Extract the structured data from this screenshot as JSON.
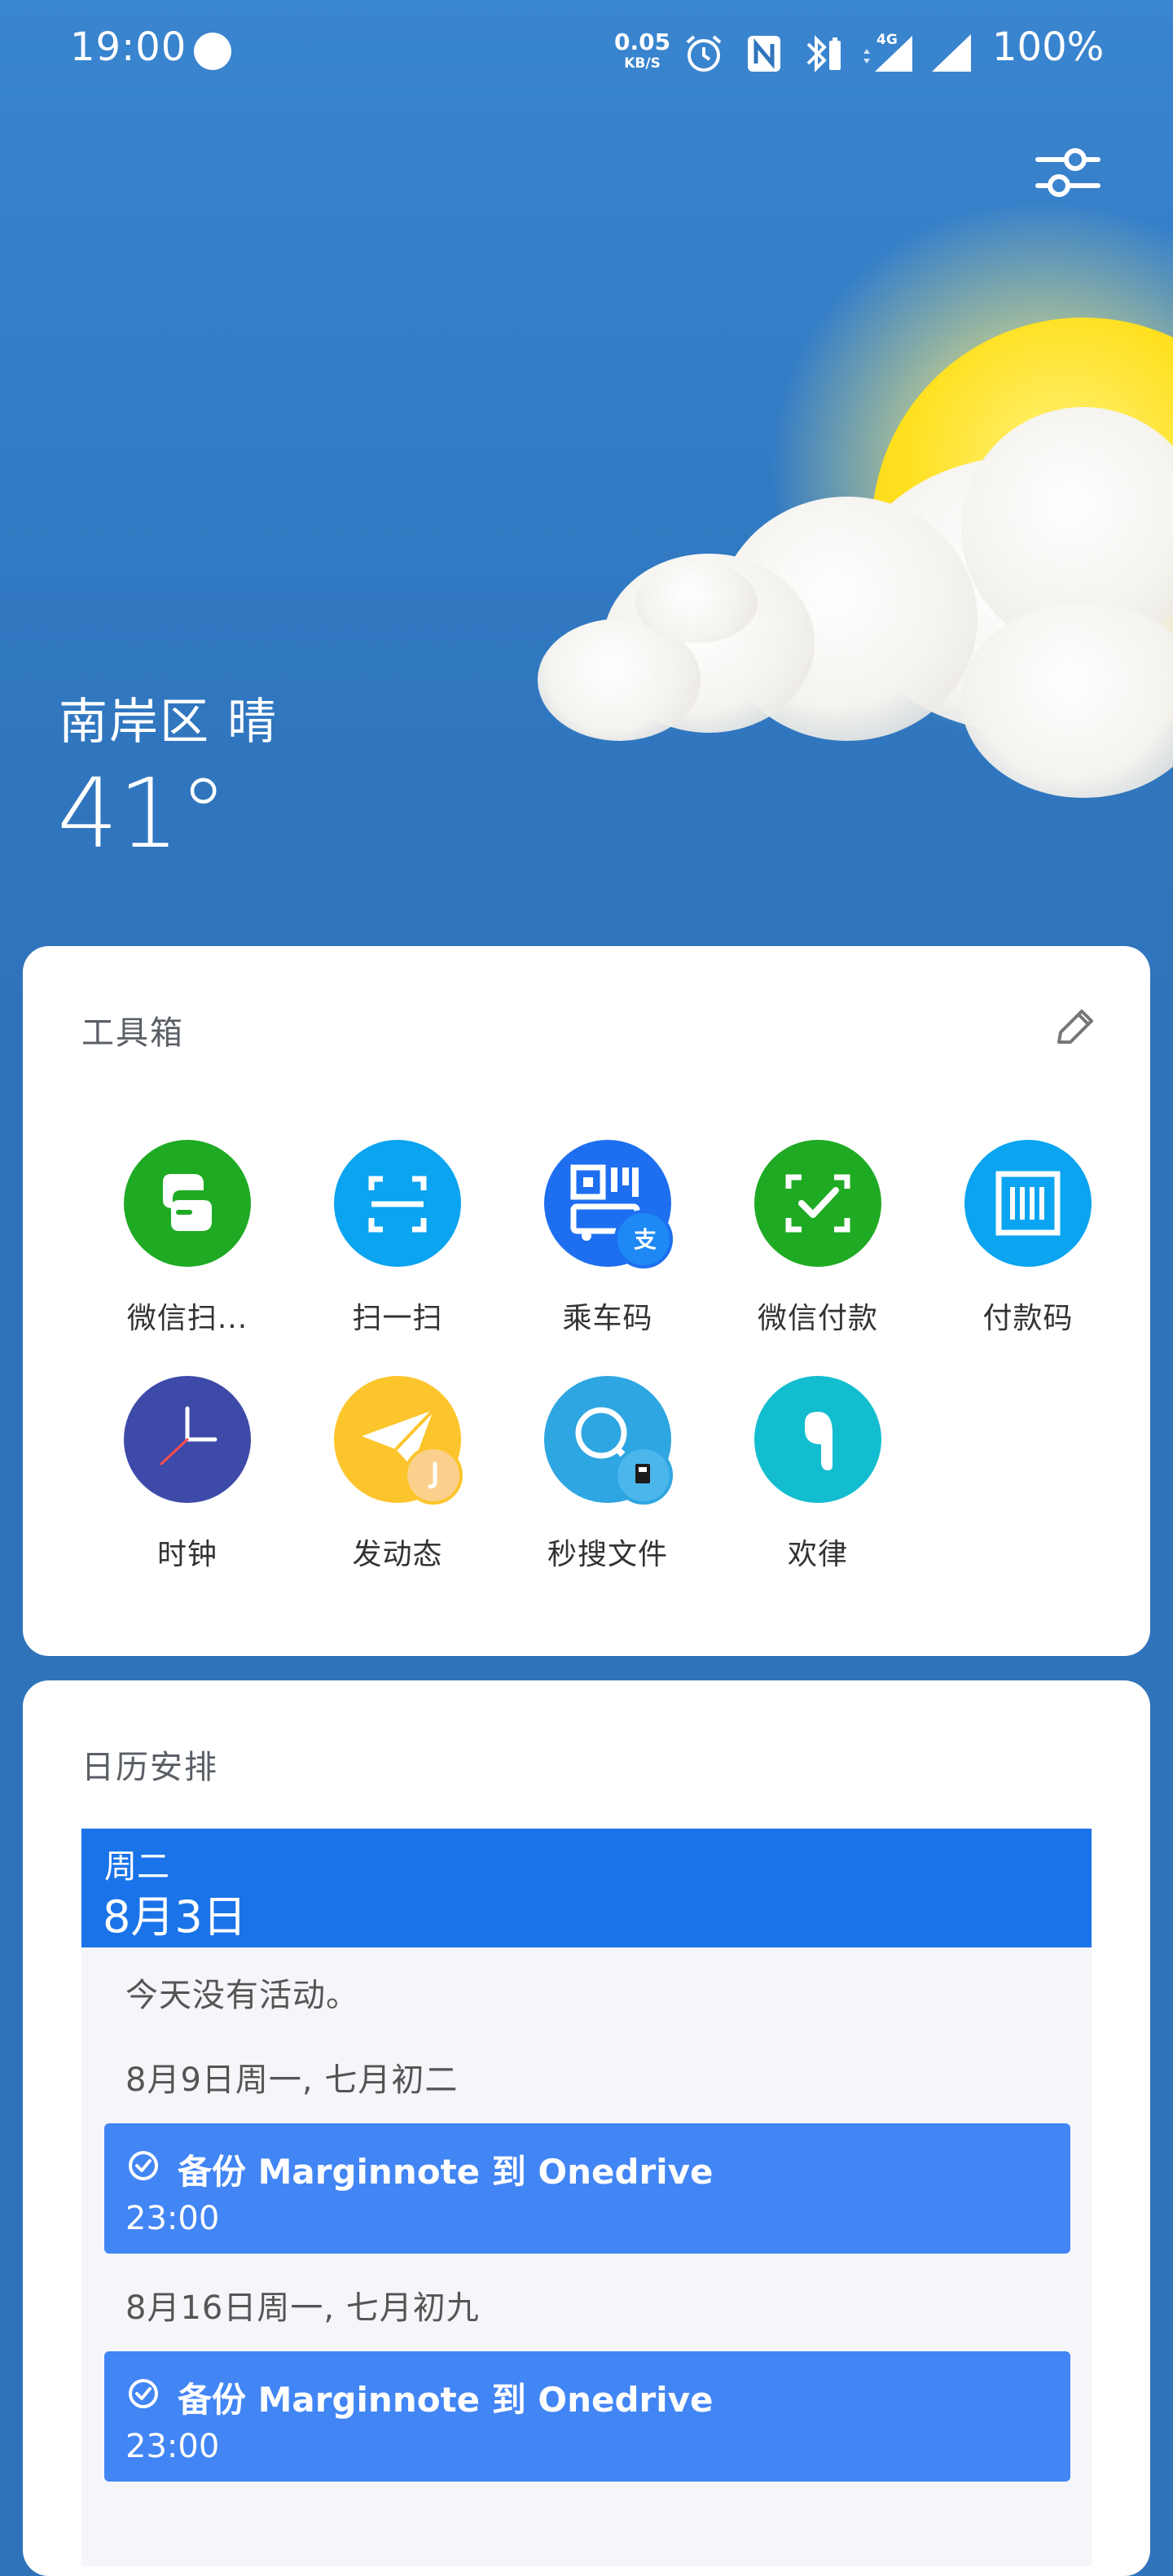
{
  "status_bar": {
    "time": "19:00",
    "net_speed_value": "0.05",
    "net_speed_unit": "KB/S",
    "network_type": "4G",
    "battery": "100%"
  },
  "weather": {
    "location": "南岸区 晴",
    "temperature": "41°"
  },
  "toolbox": {
    "title": "工具箱",
    "items": [
      {
        "label": "微信扫...",
        "icon": "wechat-scan-icon",
        "color": "#1faa24"
      },
      {
        "label": "扫一扫",
        "icon": "scan-icon",
        "color": "#0aa4f0"
      },
      {
        "label": "乘车码",
        "icon": "bus-code-icon",
        "color": "#1e6ff0"
      },
      {
        "label": "微信付款",
        "icon": "wechat-pay-icon",
        "color": "#1faa24"
      },
      {
        "label": "付款码",
        "icon": "pay-code-icon",
        "color": "#0aa4f0"
      },
      {
        "label": "时钟",
        "icon": "clock-icon",
        "color": "#3d4aa8"
      },
      {
        "label": "发动态",
        "icon": "post-icon",
        "color": "#fcc52b"
      },
      {
        "label": "秒搜文件",
        "icon": "file-search-icon",
        "color": "#2ea6e2"
      },
      {
        "label": "欢律",
        "icon": "heytap-music-icon",
        "color": "#13bdd0"
      }
    ]
  },
  "calendar": {
    "title": "日历安排",
    "day_of_week": "周二",
    "date": "8月3日",
    "no_events": "今天没有活动。",
    "groups": [
      {
        "heading": "8月9日周一, 七月初二",
        "event_title": "备份 Marginnote 到 Onedrive",
        "event_time": "23:00"
      },
      {
        "heading": "8月16日周一, 七月初九",
        "event_title": "备份 Marginnote 到 Onedrive",
        "event_time": "23:00"
      }
    ]
  }
}
